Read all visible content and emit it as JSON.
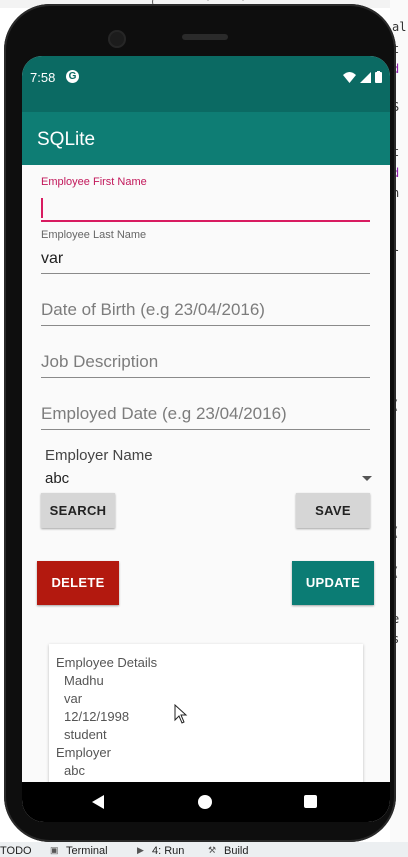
{
  "ide": {
    "right_chars": [
      "al",
      "t",
      "d",
      "S",
      "t",
      "d",
      "n",
      "l",
      "(",
      "(",
      "(",
      "e",
      "s"
    ],
    "top_chars": [
      "(",
      "'",
      "'"
    ],
    "bottom_tabs": [
      "TODO",
      "Terminal",
      "4: Run",
      "Build"
    ]
  },
  "status_bar": {
    "time": "7:58",
    "g_icon": "G"
  },
  "app_bar": {
    "title": "SQLite"
  },
  "form": {
    "first_name": {
      "label": "Employee First Name",
      "value": ""
    },
    "last_name": {
      "label": "Employee Last Name",
      "value": "var"
    },
    "dob": {
      "placeholder": "Date of Birth (e.g 23/04/2016)"
    },
    "job": {
      "placeholder": "Job Description"
    },
    "employed": {
      "placeholder": "Employed Date (e.g 23/04/2016)"
    },
    "employer_label": "Employer Name",
    "employer_selected": "abc"
  },
  "buttons": {
    "search": "SEARCH",
    "save": "SAVE",
    "delete": "DELETE",
    "update": "UPDATE"
  },
  "details": {
    "heading": "Employee Details",
    "lines": [
      "Madhu",
      "var",
      "12/12/1998",
      "student"
    ],
    "employer_heading": "Employer",
    "employer_value": "abc"
  },
  "colors": {
    "primary": "#0e7d74",
    "primary_dark": "#0b6a63",
    "accent": "#d81b60",
    "delete": "#b3190f"
  }
}
